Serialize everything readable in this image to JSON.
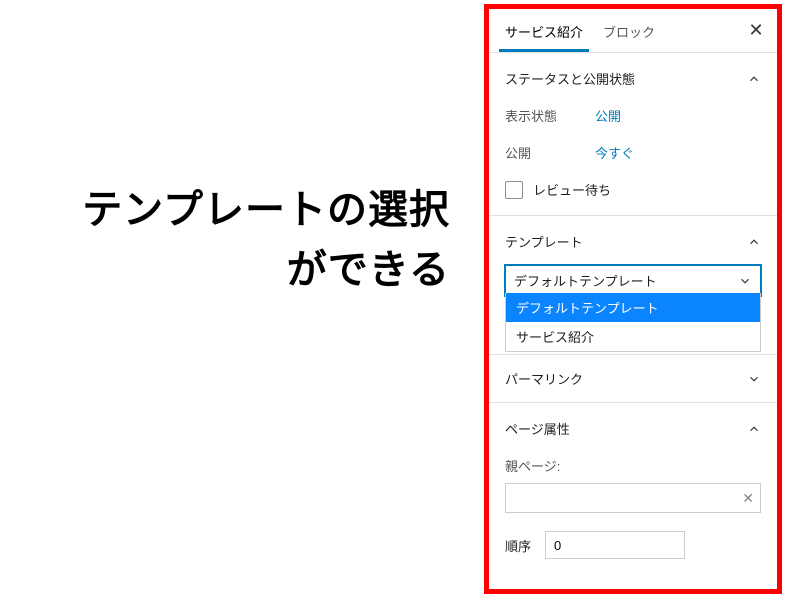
{
  "annotation": {
    "line1": "テンプレートの選択",
    "line2": "ができる"
  },
  "tabs": {
    "service": "サービス紹介",
    "block": "ブロック"
  },
  "status_section": {
    "title": "ステータスと公開状態",
    "visibility_label": "表示状態",
    "visibility_value": "公開",
    "publish_label": "公開",
    "publish_value": "今すぐ",
    "review_label": "レビュー待ち"
  },
  "template_section": {
    "title": "テンプレート",
    "selected": "デフォルトテンプレート",
    "options": {
      "default": "デフォルトテンプレート",
      "service": "サービス紹介"
    }
  },
  "permalink_section": {
    "title": "パーマリンク"
  },
  "page_attr_section": {
    "title": "ページ属性",
    "parent_label": "親ページ:",
    "order_label": "順序",
    "order_value": "0"
  }
}
